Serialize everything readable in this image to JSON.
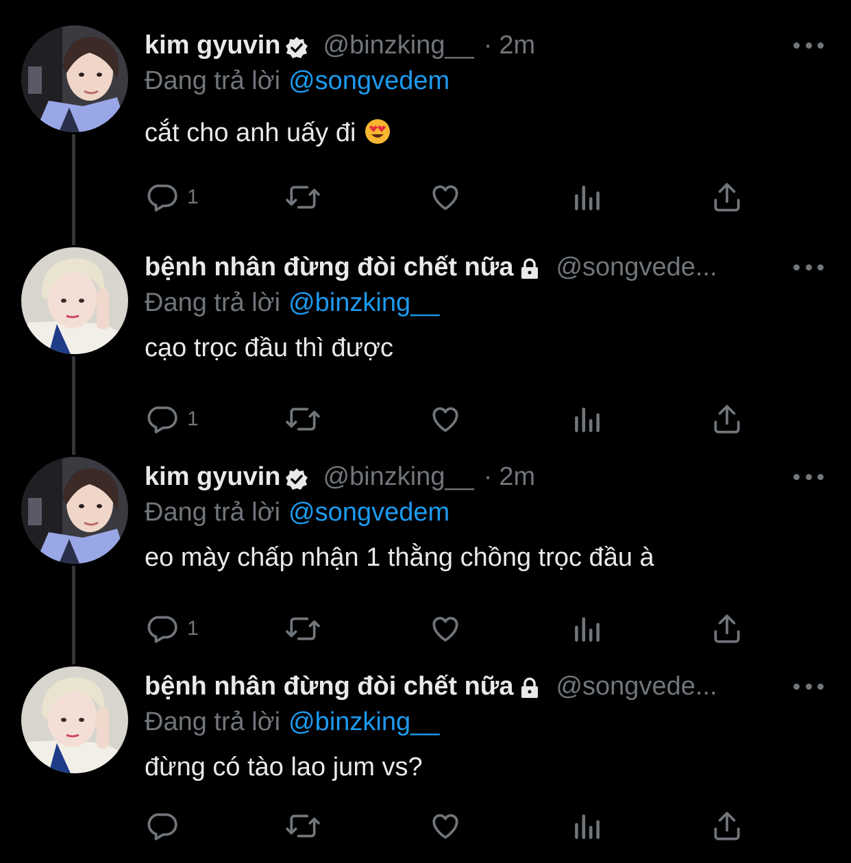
{
  "colors": {
    "background": "#000000",
    "text": "#e7e9ea",
    "muted": "#71767b",
    "mention": "#1d9bf0",
    "thread_line": "#333639"
  },
  "reply_prefix": "Đang trả lời",
  "tweets": [
    {
      "display_name": "kim gyuvin",
      "badge": "verified-icon",
      "handle": "@binzking__",
      "separator": "·",
      "time": "2m",
      "reply_to": "@songvedem",
      "text": "cắt cho anh uấy đi",
      "emoji": "heart-eyes-emoji",
      "reply_count": "1"
    },
    {
      "display_name": "bệnh nhân đừng đòi chết nữa",
      "badge": "lock-icon",
      "handle": "@songvede...",
      "reply_to": "@binzking__",
      "text": "cạo trọc đầu thì được",
      "reply_count": "1"
    },
    {
      "display_name": "kim gyuvin",
      "badge": "verified-icon",
      "handle": "@binzking__",
      "separator": "·",
      "time": "2m",
      "reply_to": "@songvedem",
      "text": "eo mày chấp nhận 1 thằng chồng trọc đầu à",
      "reply_count": "1"
    },
    {
      "display_name": "bệnh nhân đừng đòi chết nữa",
      "badge": "lock-icon",
      "handle": "@songvede...",
      "reply_to": "@binzking__",
      "text": "đừng có tào lao jum vs?",
      "reply_count": ""
    }
  ],
  "action_icons": [
    "reply-icon",
    "retweet-icon",
    "like-icon",
    "views-icon",
    "share-icon"
  ]
}
